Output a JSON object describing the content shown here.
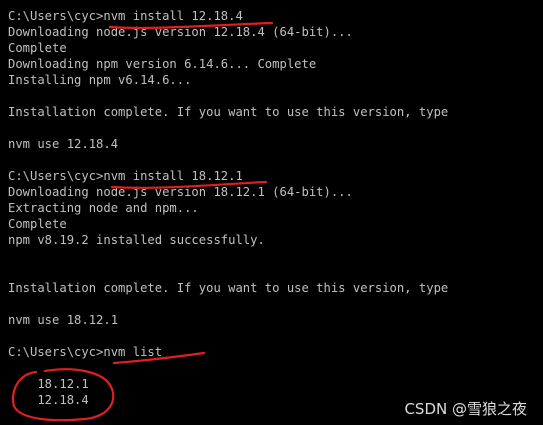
{
  "terminal": {
    "lines": [
      "C:\\Users\\cyc>nvm install 12.18.4",
      "Downloading node.js version 12.18.4 (64-bit)...",
      "Complete",
      "Downloading npm version 6.14.6... Complete",
      "Installing npm v6.14.6...",
      "",
      "Installation complete. If you want to use this version, type",
      "",
      "nvm use 12.18.4",
      "",
      "C:\\Users\\cyc>nvm install 18.12.1",
      "Downloading node.js version 18.12.1 (64-bit)...",
      "Extracting node and npm...",
      "Complete",
      "npm v8.19.2 installed successfully.",
      "",
      "",
      "Installation complete. If you want to use this version, type",
      "",
      "nvm use 18.12.1",
      "",
      "C:\\Users\\cyc>nvm list",
      "",
      "    18.12.1",
      "    12.18.4"
    ]
  },
  "watermark": "CSDN @雪狼之夜",
  "colors": {
    "background": "#000000",
    "text": "#c0c0c0",
    "annotation": "#e02020"
  }
}
